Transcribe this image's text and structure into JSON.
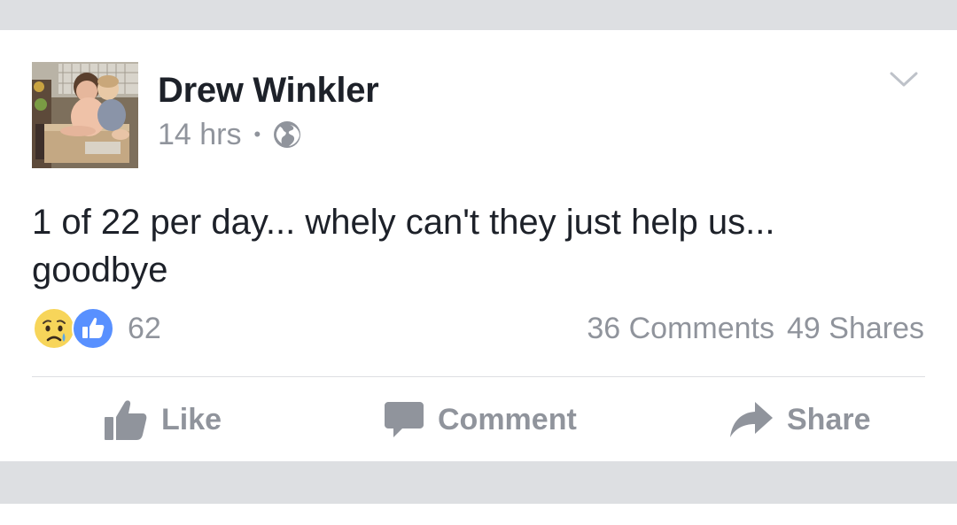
{
  "post": {
    "author": "Drew Winkler",
    "time": "14 hrs",
    "separator": "•",
    "privacy_icon": "globe-icon",
    "text": "1 of 22 per day... whely can't they just help us... goodbye"
  },
  "reactions": {
    "icons": [
      "sad-reaction-icon",
      "like-reaction-icon"
    ],
    "count": "62"
  },
  "engagement": {
    "comments": "36 Comments",
    "shares": "49 Shares"
  },
  "actions": {
    "like": "Like",
    "comment": "Comment",
    "share": "Share"
  },
  "colors": {
    "text_primary": "#1d2129",
    "text_secondary": "#90949c",
    "background_band": "#dddfe2",
    "like_blue": "#5890ff",
    "sad_yellow": "#f7d55a"
  }
}
